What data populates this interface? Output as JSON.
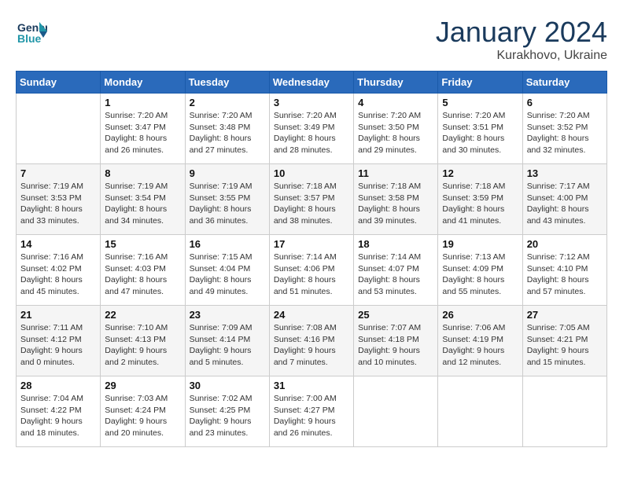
{
  "header": {
    "logo_line1": "General",
    "logo_line2": "Blue",
    "month_title": "January 2024",
    "location": "Kurakhovo, Ukraine"
  },
  "weekdays": [
    "Sunday",
    "Monday",
    "Tuesday",
    "Wednesday",
    "Thursday",
    "Friday",
    "Saturday"
  ],
  "weeks": [
    [
      {
        "day": "",
        "sunrise": "",
        "sunset": "",
        "daylight": ""
      },
      {
        "day": "1",
        "sunrise": "7:20 AM",
        "sunset": "3:47 PM",
        "daylight": "8 hours and 26 minutes."
      },
      {
        "day": "2",
        "sunrise": "7:20 AM",
        "sunset": "3:48 PM",
        "daylight": "8 hours and 27 minutes."
      },
      {
        "day": "3",
        "sunrise": "7:20 AM",
        "sunset": "3:49 PM",
        "daylight": "8 hours and 28 minutes."
      },
      {
        "day": "4",
        "sunrise": "7:20 AM",
        "sunset": "3:50 PM",
        "daylight": "8 hours and 29 minutes."
      },
      {
        "day": "5",
        "sunrise": "7:20 AM",
        "sunset": "3:51 PM",
        "daylight": "8 hours and 30 minutes."
      },
      {
        "day": "6",
        "sunrise": "7:20 AM",
        "sunset": "3:52 PM",
        "daylight": "8 hours and 32 minutes."
      }
    ],
    [
      {
        "day": "7",
        "sunrise": "7:19 AM",
        "sunset": "3:53 PM",
        "daylight": "8 hours and 33 minutes."
      },
      {
        "day": "8",
        "sunrise": "7:19 AM",
        "sunset": "3:54 PM",
        "daylight": "8 hours and 34 minutes."
      },
      {
        "day": "9",
        "sunrise": "7:19 AM",
        "sunset": "3:55 PM",
        "daylight": "8 hours and 36 minutes."
      },
      {
        "day": "10",
        "sunrise": "7:18 AM",
        "sunset": "3:57 PM",
        "daylight": "8 hours and 38 minutes."
      },
      {
        "day": "11",
        "sunrise": "7:18 AM",
        "sunset": "3:58 PM",
        "daylight": "8 hours and 39 minutes."
      },
      {
        "day": "12",
        "sunrise": "7:18 AM",
        "sunset": "3:59 PM",
        "daylight": "8 hours and 41 minutes."
      },
      {
        "day": "13",
        "sunrise": "7:17 AM",
        "sunset": "4:00 PM",
        "daylight": "8 hours and 43 minutes."
      }
    ],
    [
      {
        "day": "14",
        "sunrise": "7:16 AM",
        "sunset": "4:02 PM",
        "daylight": "8 hours and 45 minutes."
      },
      {
        "day": "15",
        "sunrise": "7:16 AM",
        "sunset": "4:03 PM",
        "daylight": "8 hours and 47 minutes."
      },
      {
        "day": "16",
        "sunrise": "7:15 AM",
        "sunset": "4:04 PM",
        "daylight": "8 hours and 49 minutes."
      },
      {
        "day": "17",
        "sunrise": "7:14 AM",
        "sunset": "4:06 PM",
        "daylight": "8 hours and 51 minutes."
      },
      {
        "day": "18",
        "sunrise": "7:14 AM",
        "sunset": "4:07 PM",
        "daylight": "8 hours and 53 minutes."
      },
      {
        "day": "19",
        "sunrise": "7:13 AM",
        "sunset": "4:09 PM",
        "daylight": "8 hours and 55 minutes."
      },
      {
        "day": "20",
        "sunrise": "7:12 AM",
        "sunset": "4:10 PM",
        "daylight": "8 hours and 57 minutes."
      }
    ],
    [
      {
        "day": "21",
        "sunrise": "7:11 AM",
        "sunset": "4:12 PM",
        "daylight": "9 hours and 0 minutes."
      },
      {
        "day": "22",
        "sunrise": "7:10 AM",
        "sunset": "4:13 PM",
        "daylight": "9 hours and 2 minutes."
      },
      {
        "day": "23",
        "sunrise": "7:09 AM",
        "sunset": "4:14 PM",
        "daylight": "9 hours and 5 minutes."
      },
      {
        "day": "24",
        "sunrise": "7:08 AM",
        "sunset": "4:16 PM",
        "daylight": "9 hours and 7 minutes."
      },
      {
        "day": "25",
        "sunrise": "7:07 AM",
        "sunset": "4:18 PM",
        "daylight": "9 hours and 10 minutes."
      },
      {
        "day": "26",
        "sunrise": "7:06 AM",
        "sunset": "4:19 PM",
        "daylight": "9 hours and 12 minutes."
      },
      {
        "day": "27",
        "sunrise": "7:05 AM",
        "sunset": "4:21 PM",
        "daylight": "9 hours and 15 minutes."
      }
    ],
    [
      {
        "day": "28",
        "sunrise": "7:04 AM",
        "sunset": "4:22 PM",
        "daylight": "9 hours and 18 minutes."
      },
      {
        "day": "29",
        "sunrise": "7:03 AM",
        "sunset": "4:24 PM",
        "daylight": "9 hours and 20 minutes."
      },
      {
        "day": "30",
        "sunrise": "7:02 AM",
        "sunset": "4:25 PM",
        "daylight": "9 hours and 23 minutes."
      },
      {
        "day": "31",
        "sunrise": "7:00 AM",
        "sunset": "4:27 PM",
        "daylight": "9 hours and 26 minutes."
      },
      {
        "day": "",
        "sunrise": "",
        "sunset": "",
        "daylight": ""
      },
      {
        "day": "",
        "sunrise": "",
        "sunset": "",
        "daylight": ""
      },
      {
        "day": "",
        "sunrise": "",
        "sunset": "",
        "daylight": ""
      }
    ]
  ]
}
